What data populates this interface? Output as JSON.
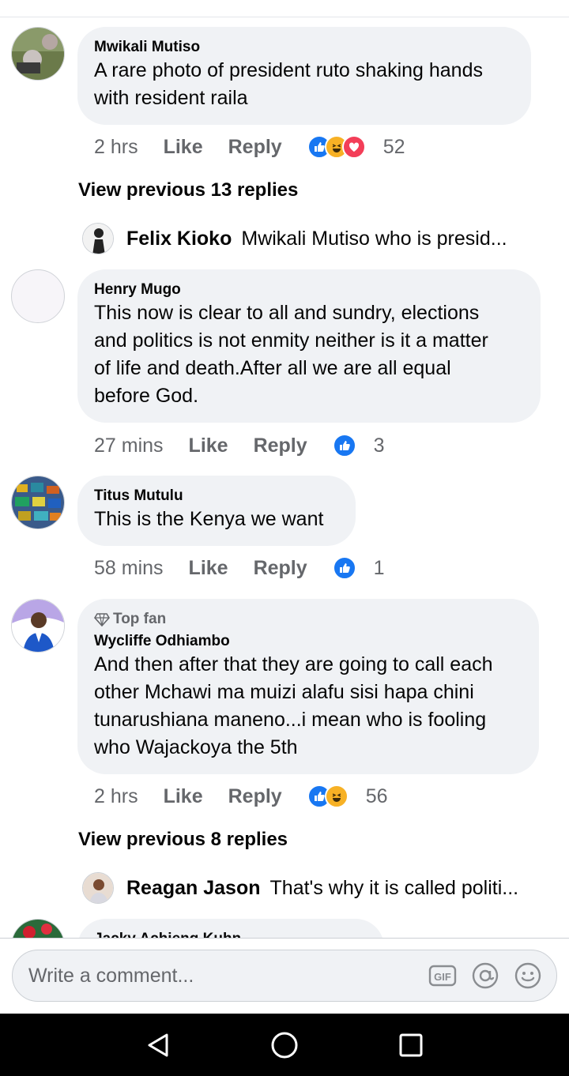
{
  "comments": [
    {
      "author": "Mwikali Mutiso",
      "lines": [
        "A rare photo of president ruto shaking hands",
        "with resident raila"
      ],
      "time": "2 hrs",
      "like": "Like",
      "reply": "Reply",
      "reactions": [
        "like",
        "haha",
        "love"
      ],
      "count": "52"
    },
    {
      "author": "Henry Mugo",
      "lines": [
        "This now is clear to all and sundry, elections",
        "and politics is not enmity neither is it a matter",
        "of life and death.After all we are all equal",
        "before God."
      ],
      "time": "27 mins",
      "like": "Like",
      "reply": "Reply",
      "reactions": [
        "like"
      ],
      "count": "3"
    },
    {
      "author": "Titus Mutulu",
      "lines": [
        "This is the Kenya we want"
      ],
      "time": "58 mins",
      "like": "Like",
      "reply": "Reply",
      "reactions": [
        "like"
      ],
      "count": "1"
    },
    {
      "badge": "Top fan",
      "author": "Wycliffe Odhiambo",
      "lines": [
        "And then after that they are going to call each",
        "other Mchawi ma muizi alafu sisi hapa chini",
        "tunarushiana maneno...i mean who is fooling",
        "who Wajackoya the 5th"
      ],
      "time": "2 hrs",
      "like": "Like",
      "reply": "Reply",
      "reactions": [
        "like",
        "haha"
      ],
      "count": "56"
    },
    {
      "author": "Jacky Achieng Kuhn"
    }
  ],
  "view_previous": [
    "View previous 13 replies",
    "View previous 8 replies"
  ],
  "reply_previews": [
    {
      "name": "Felix Kioko",
      "text": "Mwikali Mutiso who is presid..."
    },
    {
      "name": "Reagan Jason",
      "text": "That's why it is called politi..."
    }
  ],
  "composer": {
    "placeholder": "Write a comment..."
  },
  "colors": {
    "accent": "#1877f2",
    "bubble": "#f0f2f5",
    "muted": "#65676b"
  }
}
